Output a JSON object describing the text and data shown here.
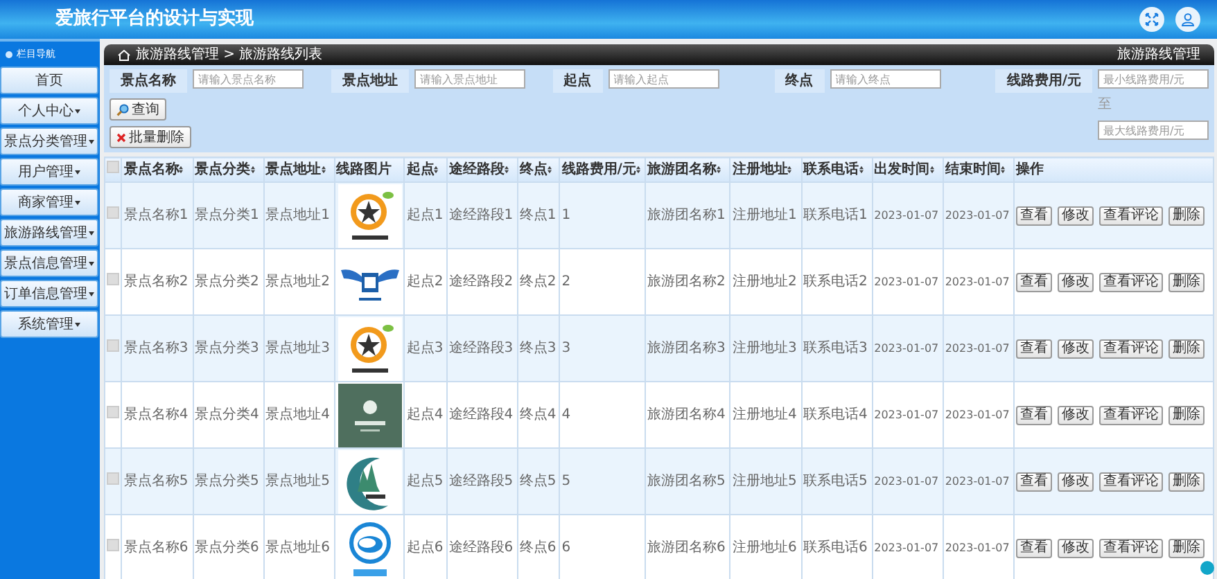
{
  "header": {
    "title": "爱旅行平台的设计与实现"
  },
  "sidebar": {
    "title": "栏目导航",
    "items": [
      {
        "label": "首页",
        "has_menu": false
      },
      {
        "label": "个人中心",
        "has_menu": true
      },
      {
        "label": "景点分类管理",
        "has_menu": true
      },
      {
        "label": "用户管理",
        "has_menu": true
      },
      {
        "label": "商家管理",
        "has_menu": true
      },
      {
        "label": "旅游路线管理",
        "has_menu": true
      },
      {
        "label": "景点信息管理",
        "has_menu": true
      },
      {
        "label": "订单信息管理",
        "has_menu": true
      },
      {
        "label": "系统管理",
        "has_menu": true
      }
    ]
  },
  "breadcrumb": {
    "path": "旅游路线管理 > 旅游路线列表",
    "right": "旅游路线管理"
  },
  "filters": [
    {
      "label": "景点名称",
      "placeholder": "请输入景点名称"
    },
    {
      "label": "景点地址",
      "placeholder": "请输入景点地址"
    },
    {
      "label": "起点",
      "placeholder": "请输入起点"
    },
    {
      "label": "终点",
      "placeholder": "请输入终点"
    },
    {
      "label": "线路费用/元",
      "placeholder": "最小线路费用/元",
      "separator": "至",
      "placeholder_max": "最大线路费用/元"
    }
  ],
  "search_button": "查询",
  "batch_delete_button": "批量删除",
  "table": {
    "select_all": {
      "checked": false
    },
    "columns": [
      {
        "label": "景点名称",
        "kind": "text",
        "sortable": true
      },
      {
        "label": "景点分类",
        "kind": "text",
        "sortable": true
      },
      {
        "label": "景点地址",
        "kind": "text",
        "sortable": true
      },
      {
        "label": "线路图片",
        "sortable": false
      },
      {
        "label": "起点",
        "kind": "text",
        "sortable": true
      },
      {
        "label": "途经路段",
        "kind": "text",
        "sortable": true
      },
      {
        "label": "终点",
        "kind": "text",
        "sortable": true
      },
      {
        "label": "线路费用/元",
        "kind": "text",
        "sortable": true
      },
      {
        "label": "旅游团名称",
        "kind": "text",
        "sortable": true
      },
      {
        "label": "注册地址",
        "kind": "text",
        "sortable": true
      },
      {
        "label": "联系电话",
        "kind": "text",
        "sortable": true
      },
      {
        "label": "出发时间",
        "kind": "date",
        "sortable": true
      },
      {
        "label": "结束时间",
        "kind": "date",
        "sortable": true
      },
      {
        "label": "操作",
        "kind": "actions",
        "sortable": false
      }
    ],
    "rows": [
      {
        "checked": false,
        "cells": [
          "景点名称1",
          "景点分类1",
          "景点地址1",
          {
            "kind": "picture"
          },
          "起点1",
          "途经路段1",
          "终点1",
          "1",
          "旅游团名称1",
          "注册地址1",
          "联系电话1",
          "2023-01-07",
          "2023-01-07",
          [
            "查看",
            "修改",
            "查看评论",
            "删除"
          ]
        ]
      },
      {
        "checked": false,
        "cells": [
          "景点名称2",
          "景点分类2",
          "景点地址2",
          {
            "kind": "picture"
          },
          "起点2",
          "途经路段2",
          "终点2",
          "2",
          "旅游团名称2",
          "注册地址2",
          "联系电话2",
          "2023-01-07",
          "2023-01-07",
          [
            "查看",
            "修改",
            "查看评论",
            "删除"
          ]
        ]
      },
      {
        "checked": false,
        "cells": [
          "景点名称3",
          "景点分类3",
          "景点地址3",
          {
            "kind": "picture"
          },
          "起点3",
          "途经路段3",
          "终点3",
          "3",
          "旅游团名称3",
          "注册地址3",
          "联系电话3",
          "2023-01-07",
          "2023-01-07",
          [
            "查看",
            "修改",
            "查看评论",
            "删除"
          ]
        ]
      },
      {
        "checked": false,
        "cells": [
          "景点名称4",
          "景点分类4",
          "景点地址4",
          {
            "kind": "picture"
          },
          "起点4",
          "途经路段4",
          "终点4",
          "4",
          "旅游团名称4",
          "注册地址4",
          "联系电话4",
          "2023-01-07",
          "2023-01-07",
          [
            "查看",
            "修改",
            "查看评论",
            "删除"
          ]
        ]
      },
      {
        "checked": false,
        "cells": [
          "景点名称5",
          "景点分类5",
          "景点地址5",
          {
            "kind": "picture"
          },
          "起点5",
          "途经路段5",
          "终点5",
          "5",
          "旅游团名称5",
          "注册地址5",
          "联系电话5",
          "2023-01-07",
          "2023-01-07",
          [
            "查看",
            "修改",
            "查看评论",
            "删除"
          ]
        ]
      },
      {
        "checked": false,
        "cells": [
          "景点名称6",
          "景点分类6",
          "景点地址6",
          {
            "kind": "picture"
          },
          "起点6",
          "途经路段6",
          "终点6",
          "6",
          "旅游团名称6",
          "注册地址6",
          "联系电话6",
          "2023-01-07",
          "2023-01-07",
          [
            "查看",
            "修改",
            "查看评论",
            "删除"
          ]
        ]
      }
    ]
  }
}
